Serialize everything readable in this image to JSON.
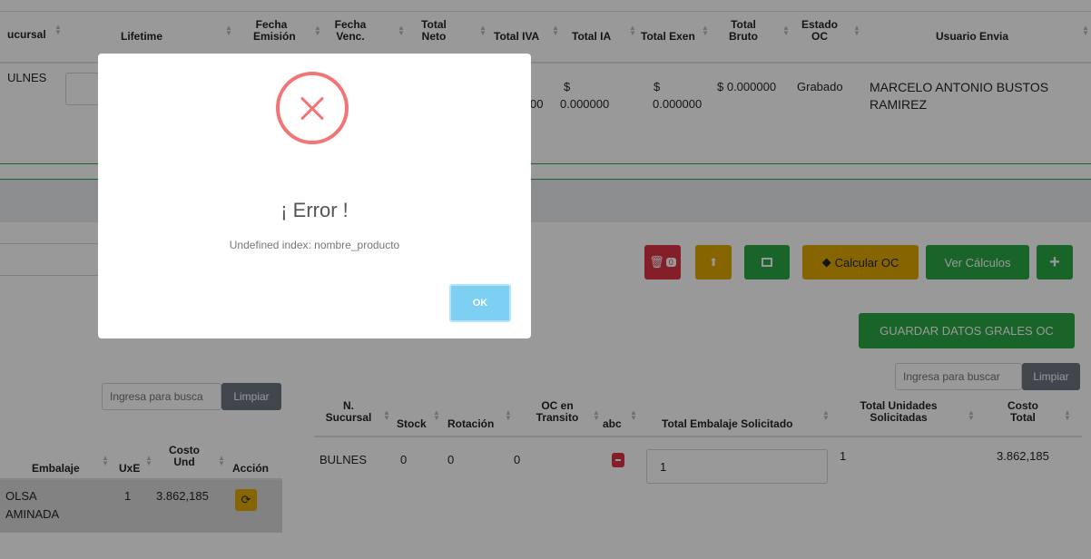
{
  "top_table": {
    "headers": [
      "ucursal",
      "Lifetime",
      "Fecha Emisión",
      "Fecha Venc.",
      "Total Neto",
      "Total IVA",
      "Total IA",
      "Total Exen",
      "Total Bruto",
      "Estado OC",
      "Usuario Envia"
    ],
    "row": {
      "sucursal": "ULNES",
      "neto_tail": "00",
      "ia_symbol": "$",
      "ia_value": "0.000000",
      "exen_symbol": "$",
      "exen_value": "0.000000",
      "bruto": "$ 0.000000",
      "estado": "Grabado",
      "usuario_line1": "MARCELO ANTONIO BUSTOS",
      "usuario_line2": "RAMIREZ"
    }
  },
  "toolbar": {
    "trash_count": "0",
    "calcular_label": "Calcular OC",
    "ver_calculos_label": "Ver Cálculos",
    "add_label": "+",
    "guardar_label": "GUARDAR DATOS GRALES OC"
  },
  "left_table": {
    "search_placeholder": "Ingresa para busca",
    "clear_label": "Limpiar",
    "headers": [
      "Embalaje",
      "UxE",
      "Costo Und",
      "Acción"
    ],
    "row": {
      "embalaje_line1": "OLSA",
      "embalaje_line2": "AMINADA",
      "uxe": "1",
      "costo": "3.862,185"
    }
  },
  "right_table": {
    "search_placeholder": "Ingresa para buscar",
    "clear_label": "Limpiar",
    "headers": [
      "N. Sucursal",
      "Stock",
      "Rotación",
      "OC en Transito",
      "abc",
      "Total Embalaje Solicitado",
      "Total Unidades Solicitadas",
      "Costo Total"
    ],
    "row": {
      "sucursal": "BULNES",
      "stock": "0",
      "rotacion": "0",
      "transito": "0",
      "embalaje_value": "1",
      "unidades": "1",
      "costo": "3.862,185"
    }
  },
  "modal": {
    "title": "¡ Error !",
    "message": "Undefined index: nombre_producto",
    "ok_label": "OK"
  },
  "colors": {
    "danger": "#dc3545",
    "warning": "#e0a800",
    "success": "#28a745",
    "ok_button": "#7ecff4",
    "error_icon": "#f27474"
  }
}
